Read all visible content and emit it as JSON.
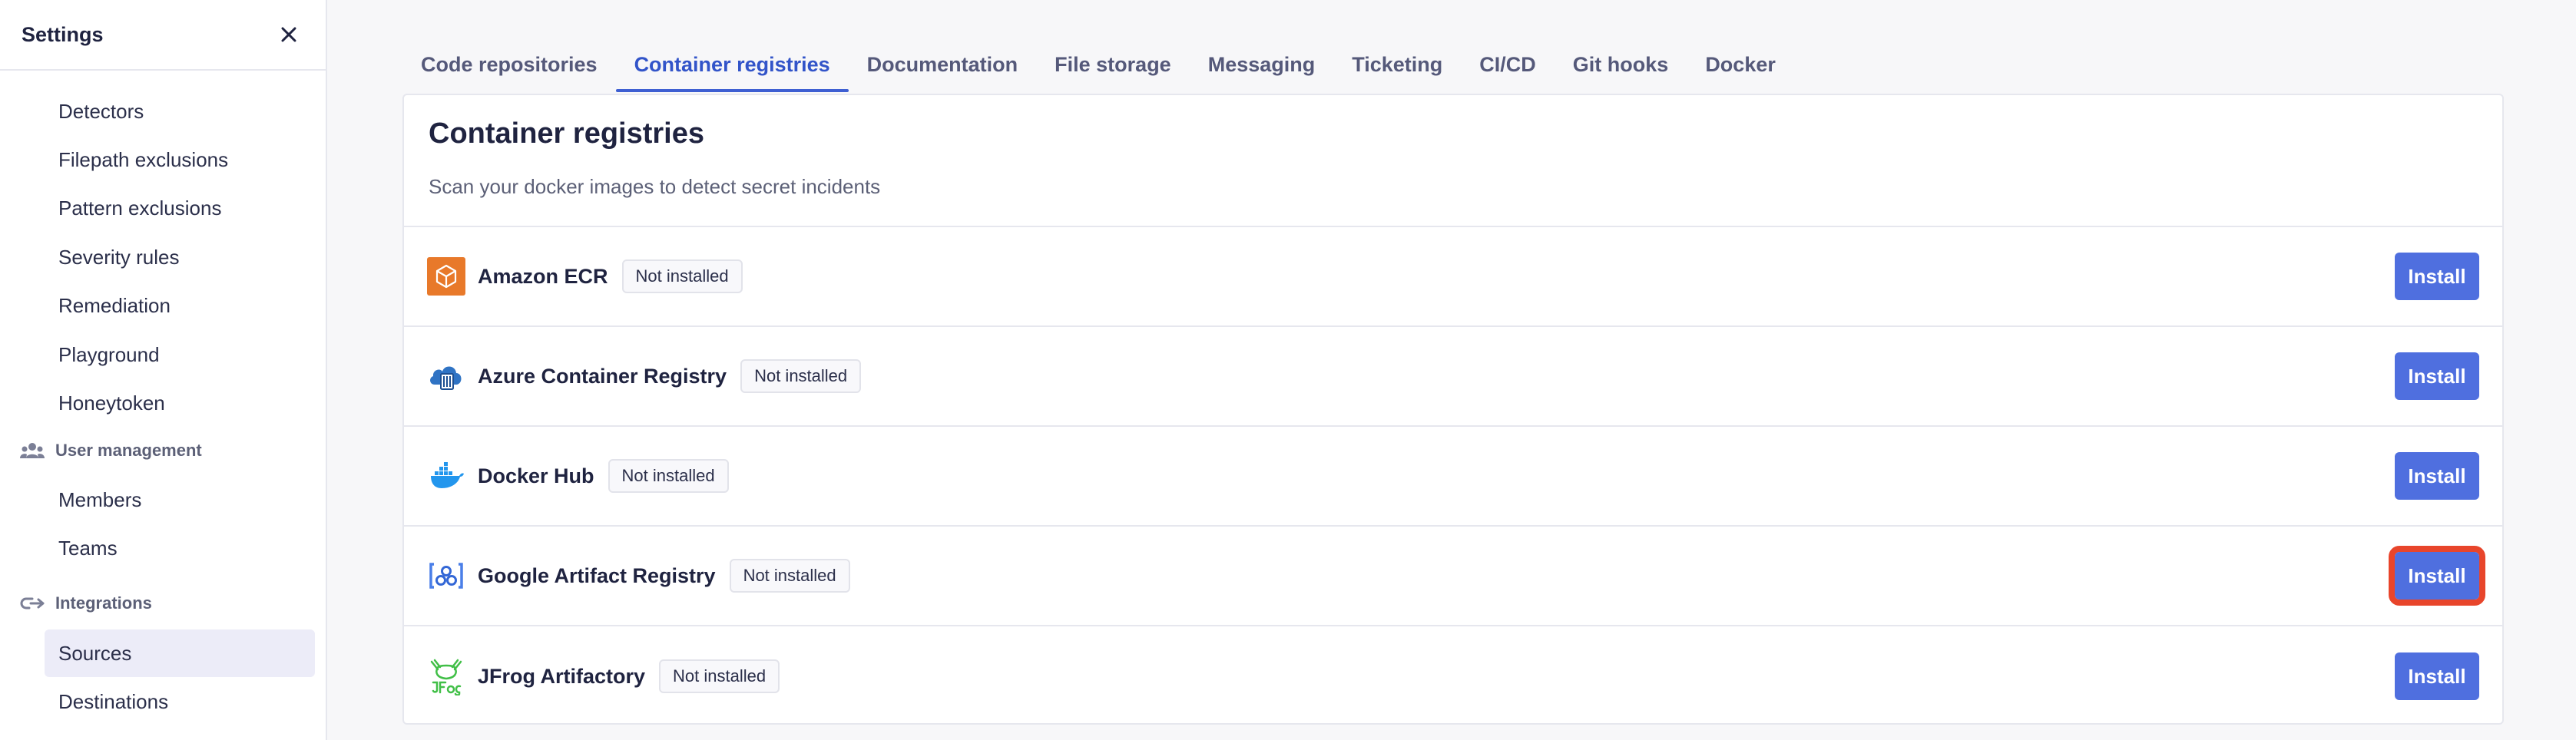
{
  "sidebar": {
    "title": "Settings",
    "items_top": [
      {
        "label": "Detectors"
      },
      {
        "label": "Filepath exclusions"
      },
      {
        "label": "Pattern exclusions"
      },
      {
        "label": "Severity rules"
      },
      {
        "label": "Remediation"
      },
      {
        "label": "Playground"
      },
      {
        "label": "Honeytoken"
      }
    ],
    "user_management": {
      "label": "User management",
      "icon": "users-icon",
      "items": [
        {
          "label": "Members"
        },
        {
          "label": "Teams"
        }
      ]
    },
    "integrations": {
      "label": "Integrations",
      "icon": "integrations-icon",
      "items": [
        {
          "label": "Sources",
          "active": true
        },
        {
          "label": "Destinations"
        }
      ]
    }
  },
  "tabs": [
    {
      "label": "Code repositories"
    },
    {
      "label": "Container registries",
      "active": true
    },
    {
      "label": "Documentation"
    },
    {
      "label": "File storage"
    },
    {
      "label": "Messaging"
    },
    {
      "label": "Ticketing"
    },
    {
      "label": "CI/CD"
    },
    {
      "label": "Git hooks"
    },
    {
      "label": "Docker"
    }
  ],
  "panel": {
    "title": "Container registries",
    "subtitle": "Scan your docker images to detect secret incidents",
    "registries": [
      {
        "name": "Amazon ECR",
        "status": "Not installed",
        "action": "Install",
        "icon": "amazon-ecr-icon",
        "color": "#e8792a"
      },
      {
        "name": "Azure Container Registry",
        "status": "Not installed",
        "action": "Install",
        "icon": "azure-container-registry-icon",
        "color": "#2f73c4"
      },
      {
        "name": "Docker Hub",
        "status": "Not installed",
        "action": "Install",
        "icon": "docker-hub-icon",
        "color": "#2396ed"
      },
      {
        "name": "Google Artifact Registry",
        "status": "Not installed",
        "action": "Install",
        "icon": "google-artifact-registry-icon",
        "color": "#4a7fe8",
        "highlighted": true
      },
      {
        "name": "JFrog Artifactory",
        "status": "Not installed",
        "action": "Install",
        "icon": "jfrog-artifactory-icon",
        "color": "#41bf47"
      }
    ]
  },
  "colors": {
    "accent": "#3254c9",
    "button": "#4f6fdf",
    "highlight": "#e8452b",
    "active_item_bg": "#ececf8"
  }
}
